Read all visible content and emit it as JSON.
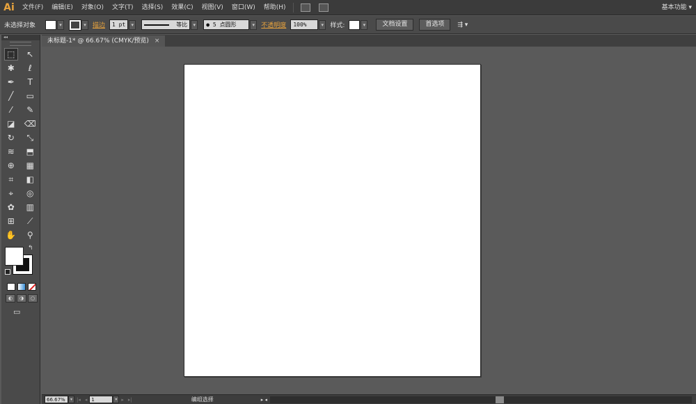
{
  "app": {
    "logo": "Ai"
  },
  "menu": {
    "items": [
      "文件(F)",
      "编辑(E)",
      "对象(O)",
      "文字(T)",
      "选择(S)",
      "效果(C)",
      "视图(V)",
      "窗口(W)",
      "帮助(H)"
    ],
    "workspace": "基本功能 ▾"
  },
  "control_bar": {
    "selection_status": "未选择对象",
    "stroke_label": "描边",
    "stroke_weight": "1 pt",
    "stroke_profile": "等比",
    "brush": "● 5 点圆形",
    "opacity_label": "不透明度",
    "opacity_value": "100%",
    "style_label": "样式:",
    "document_setup_button": "文档设置",
    "preferences_button": "首选项"
  },
  "toolpanel": {
    "header": "◂◂",
    "tools": [
      [
        "selection-tool",
        "⬚",
        "direct-selection-tool",
        "↖"
      ],
      [
        "magic-wand-tool",
        "✱",
        "lasso-tool",
        "ℓ"
      ],
      [
        "pen-tool",
        "✒",
        "type-tool",
        "T"
      ],
      [
        "line-segment-tool",
        "╱",
        "rectangle-tool",
        "▭"
      ],
      [
        "paintbrush-tool",
        "⁄",
        "pencil-tool",
        "✎"
      ],
      [
        "blob-brush-tool",
        "◪",
        "eraser-tool",
        "⌫"
      ],
      [
        "rotate-tool",
        "↻",
        "scale-tool",
        "⤡"
      ],
      [
        "warp-tool",
        "≋",
        "free-transform-tool",
        "⬒"
      ],
      [
        "shape-builder-tool",
        "⊕",
        "perspective-grid-tool",
        "▦"
      ],
      [
        "mesh-tool",
        "⌗",
        "gradient-tool",
        "◧"
      ],
      [
        "eyedropper-tool",
        "⌖",
        "blend-tool",
        "◎"
      ],
      [
        "symbol-sprayer-tool",
        "✿",
        "column-graph-tool",
        "▥"
      ],
      [
        "artboard-tool",
        "⊞",
        "slice-tool",
        "⟋"
      ],
      [
        "hand-tool",
        "✋",
        "zoom-tool",
        "⚲"
      ]
    ],
    "swap_glyph": "↰",
    "draw_modes": [
      "◐",
      "◑",
      "○"
    ],
    "screen_mode_glyph": "▭"
  },
  "document": {
    "tab_title": "未标题-1* @ 66.67% (CMYK/预览)",
    "tab_close": "×"
  },
  "status_bar": {
    "zoom": "66.67%",
    "page": "1",
    "nav_first": "|◂",
    "nav_prev": "◂",
    "nav_next": "▸",
    "nav_last": "▸|",
    "status_text": "编组选择",
    "play": "▸ ◂"
  }
}
